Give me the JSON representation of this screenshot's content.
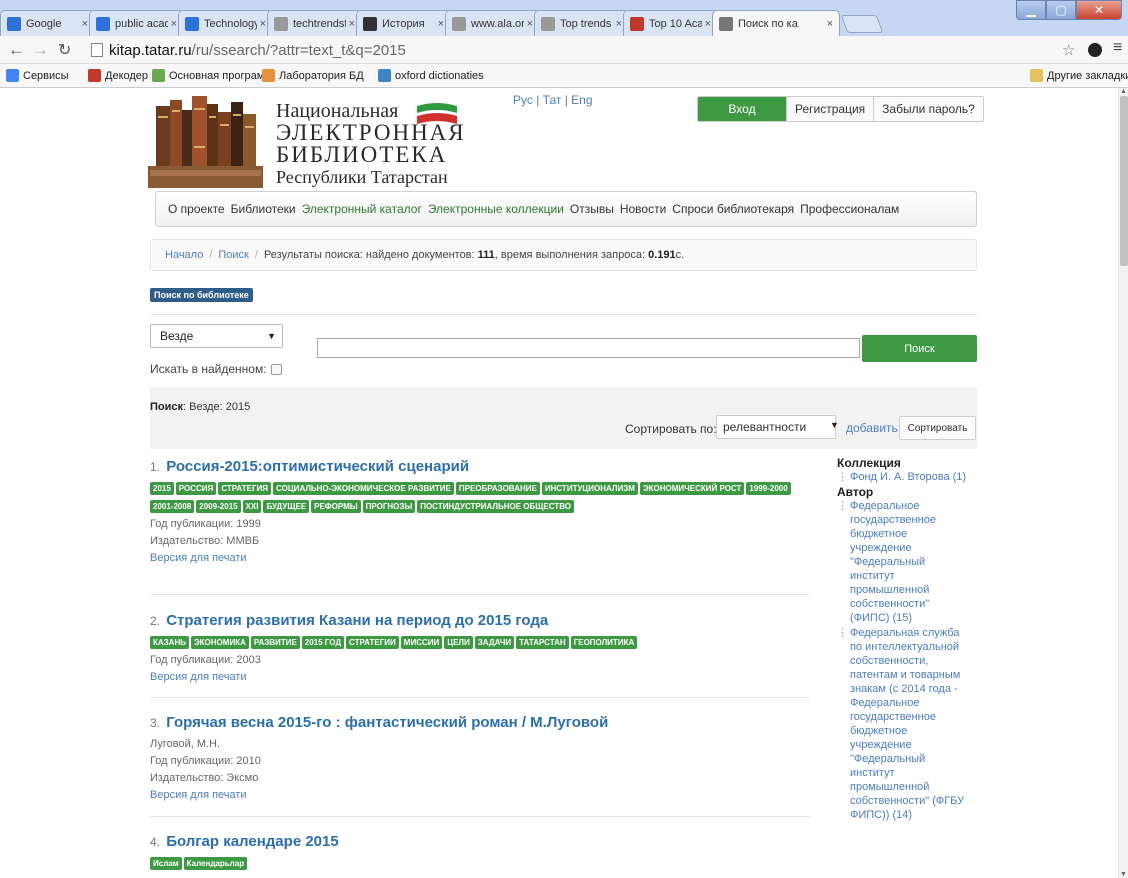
{
  "browser": {
    "tabs": [
      {
        "label": "Google",
        "icon": "google-plus-icon",
        "color": "#2c72d8"
      },
      {
        "label": "public acade",
        "icon": "google-plus-icon",
        "color": "#2c72d8"
      },
      {
        "label": "Technology",
        "icon": "photo-icon",
        "color": "#2c72d8"
      },
      {
        "label": "techtrendsfc",
        "icon": "page-icon",
        "color": "#999999"
      },
      {
        "label": "История",
        "icon": "history-icon",
        "color": "#333333"
      },
      {
        "label": "www.ala.org",
        "icon": "page-icon",
        "color": "#999999"
      },
      {
        "label": "Top trends i",
        "icon": "page-icon",
        "color": "#999999"
      },
      {
        "label": "Top 10 Acac",
        "icon": "book-icon",
        "color": "#c0392b"
      },
      {
        "label": "Поиск по ка",
        "icon": "library-icon",
        "color": "#777777"
      }
    ],
    "url_host": "kitap.tatar.ru",
    "url_path": "/ru/ssearch/?attr=text_t&q=2015",
    "bookmarks": [
      {
        "label": "Сервисы",
        "color": "#4285f4"
      },
      {
        "label": "Декодер",
        "color": "#c0392b"
      },
      {
        "label": "Основная програм...",
        "color": "#6aa84f"
      },
      {
        "label": "Лаборатория БД",
        "color": "#e69138"
      },
      {
        "label": "oxford dictionaties",
        "color": "#3d85c6"
      }
    ],
    "other_bookmarks": "Другие закладки"
  },
  "header": {
    "logo": {
      "line1": "Национальная",
      "line2": "ЭЛЕКТРОННАЯ",
      "line3": "БИБЛИОТЕКА",
      "line4": "Республики Татарстан"
    },
    "languages": [
      "Рус",
      "Тат",
      "Eng"
    ],
    "auth": {
      "login": "Вход",
      "register": "Регистрация",
      "forgot": "Забыли пароль?"
    }
  },
  "nav": [
    {
      "label": "О проекте",
      "green": false
    },
    {
      "label": "Библиотеки",
      "green": false
    },
    {
      "label": "Электронный каталог",
      "green": true
    },
    {
      "label": "Электронные коллекции",
      "green": true
    },
    {
      "label": "Отзывы",
      "green": false
    },
    {
      "label": "Новости",
      "green": false
    },
    {
      "label": "Спроси библиотекаря",
      "green": false
    },
    {
      "label": "Профессионалам",
      "green": false
    }
  ],
  "breadcrumb": {
    "home": "Начало",
    "search": "Поиск",
    "prefix": "Результаты поиска: найдено документов: ",
    "count": "111",
    "mid": ", время выполнения запроса: ",
    "time": "0.191",
    "suffix": " с."
  },
  "search": {
    "library_badge": "Поиск по библиотеке",
    "scope": "Везде",
    "query_value": "",
    "button": "Поиск",
    "in_results": "Искать в найденном:"
  },
  "results_header": {
    "query_label": "Поиск",
    "query_text": ": Везде: 2015",
    "sort_label": "Сортировать по:",
    "sort_value": "релевантности",
    "add_link": "добавить",
    "sort_button": "Сортировать"
  },
  "results": [
    {
      "num": "1.",
      "title": "Россия-2015:оптимистический сценарий",
      "tags": [
        "2015",
        "РОССИЯ",
        "СТРАТЕГИЯ",
        "СОЦИАЛЬНО-ЭКОНОМИЧЕСКОЕ РАЗВИТИЕ",
        "ПРЕОБРАЗОВАНИЕ",
        "ИНСТИТУЦИОНАЛИЗМ",
        "ЭКОНОМИЧЕСКИЙ РОСТ",
        "1999-2000",
        "2001-2008",
        "2009-2015",
        "XXI",
        "БУДУЩЕЕ",
        "РЕФОРМЫ",
        "ПРОГНОЗЫ",
        "ПОСТИНДУСТРИАЛЬНОЕ ОБЩЕСТВО"
      ],
      "meta": [
        "Год публикации: 1999",
        "Издательство: ММВБ"
      ],
      "print": "Версия для печати"
    },
    {
      "num": "2.",
      "title": "Стратегия развития Казани на период до 2015 года",
      "tags": [
        "КАЗАНЬ",
        "ЭКОНОМИКА",
        "РАЗВИТИЕ",
        "2015 ГОД",
        "СТРАТЕГИИ",
        "МИССИИ",
        "ЦЕЛИ",
        "ЗАДАЧИ",
        "ТАТАРСТАН",
        "ГЕОПОЛИТИКА"
      ],
      "meta": [
        "Год публикации: 2003"
      ],
      "print": "Версия для печати"
    },
    {
      "num": "3.",
      "title": "Горячая весна 2015-го : фантастический роман / М.Луговой",
      "tags": [],
      "meta": [
        "Луговой, М.Н.",
        "Год публикации: 2010",
        "Издательство: Эксмо"
      ],
      "print": "Версия для печати"
    },
    {
      "num": "4.",
      "title": "Болгар календаре 2015",
      "tags": [
        "Ислам",
        "Календарьлар"
      ],
      "meta": [],
      "print": ""
    }
  ],
  "facets": {
    "collection_title": "Коллекция",
    "collection_items": [
      "Фонд И. А. Второва (1)"
    ],
    "author_title": "Автор",
    "author_items": [
      "Федеральное\nгосударственное\nбюджетное\nучреждение\n\"Федеральный\nинститут\nпромышленной\nсобственности\"\n(ФИПС) (15)",
      "Федеральная служба\nпо интеллектуальной\nсобственности,\nпатентам и товарным\nзнакам (с 2014 года -\nФедеральное\nгосударственное\nбюджетное\nучреждение\n\"Федеральный\nинститут\nпромышленной\nсобственности\" (ФГБУ\nФИПС)) (14)"
    ]
  }
}
